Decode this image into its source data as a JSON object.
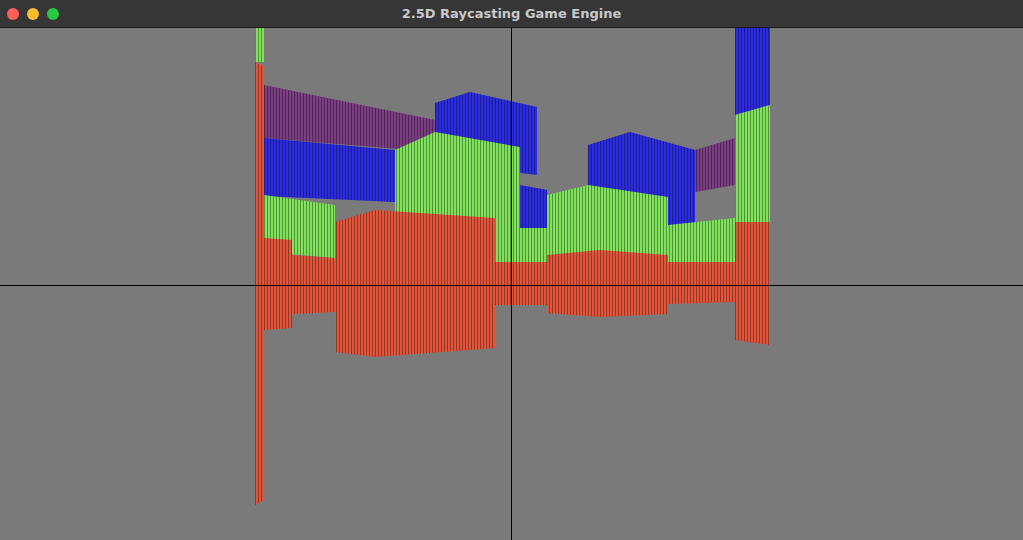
{
  "window": {
    "title": "2.5D Raycasting Game Engine"
  }
}
